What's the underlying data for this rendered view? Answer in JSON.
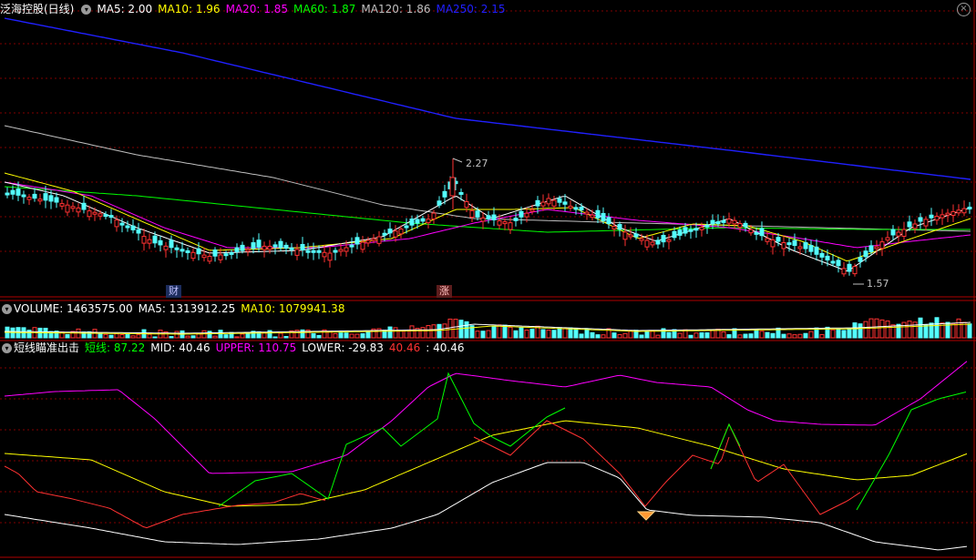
{
  "main_header": {
    "stock_title": "泛海控股(日线)",
    "ma": [
      {
        "label": "MA5: 2.00",
        "color": "#ffffff"
      },
      {
        "label": "MA10: 1.96",
        "color": "#ffff00"
      },
      {
        "label": "MA20: 1.85",
        "color": "#ff00ff"
      },
      {
        "label": "MA60: 1.87",
        "color": "#00ff00"
      },
      {
        "label": "MA120: 1.86",
        "color": "#c0c0c0"
      },
      {
        "label": "MA250: 2.15",
        "color": "#2020ff"
      }
    ],
    "close_glyph": "×"
  },
  "annotations": {
    "high_label": "2.27",
    "low_label": "1.57",
    "marker_cai": "财",
    "marker_zhang": "涨"
  },
  "volume_header": {
    "volume": "VOLUME: 1463575.00",
    "ma5": "MA5: 1313912.25",
    "ma10": "MA10: 1079941.38"
  },
  "indicator_header": {
    "name": "短线瞄准出击",
    "short_line": "短线: 87.22",
    "mid": "MID: 40.46",
    "upper": "UPPER: 110.75",
    "lower": "LOWER: -29.83",
    "red_value": "40.46",
    "white_value": ": 40.46"
  },
  "colors": {
    "up": "#ff3232",
    "down": "#54ffff",
    "grid": "#800000",
    "separator": "#b00000"
  }
}
